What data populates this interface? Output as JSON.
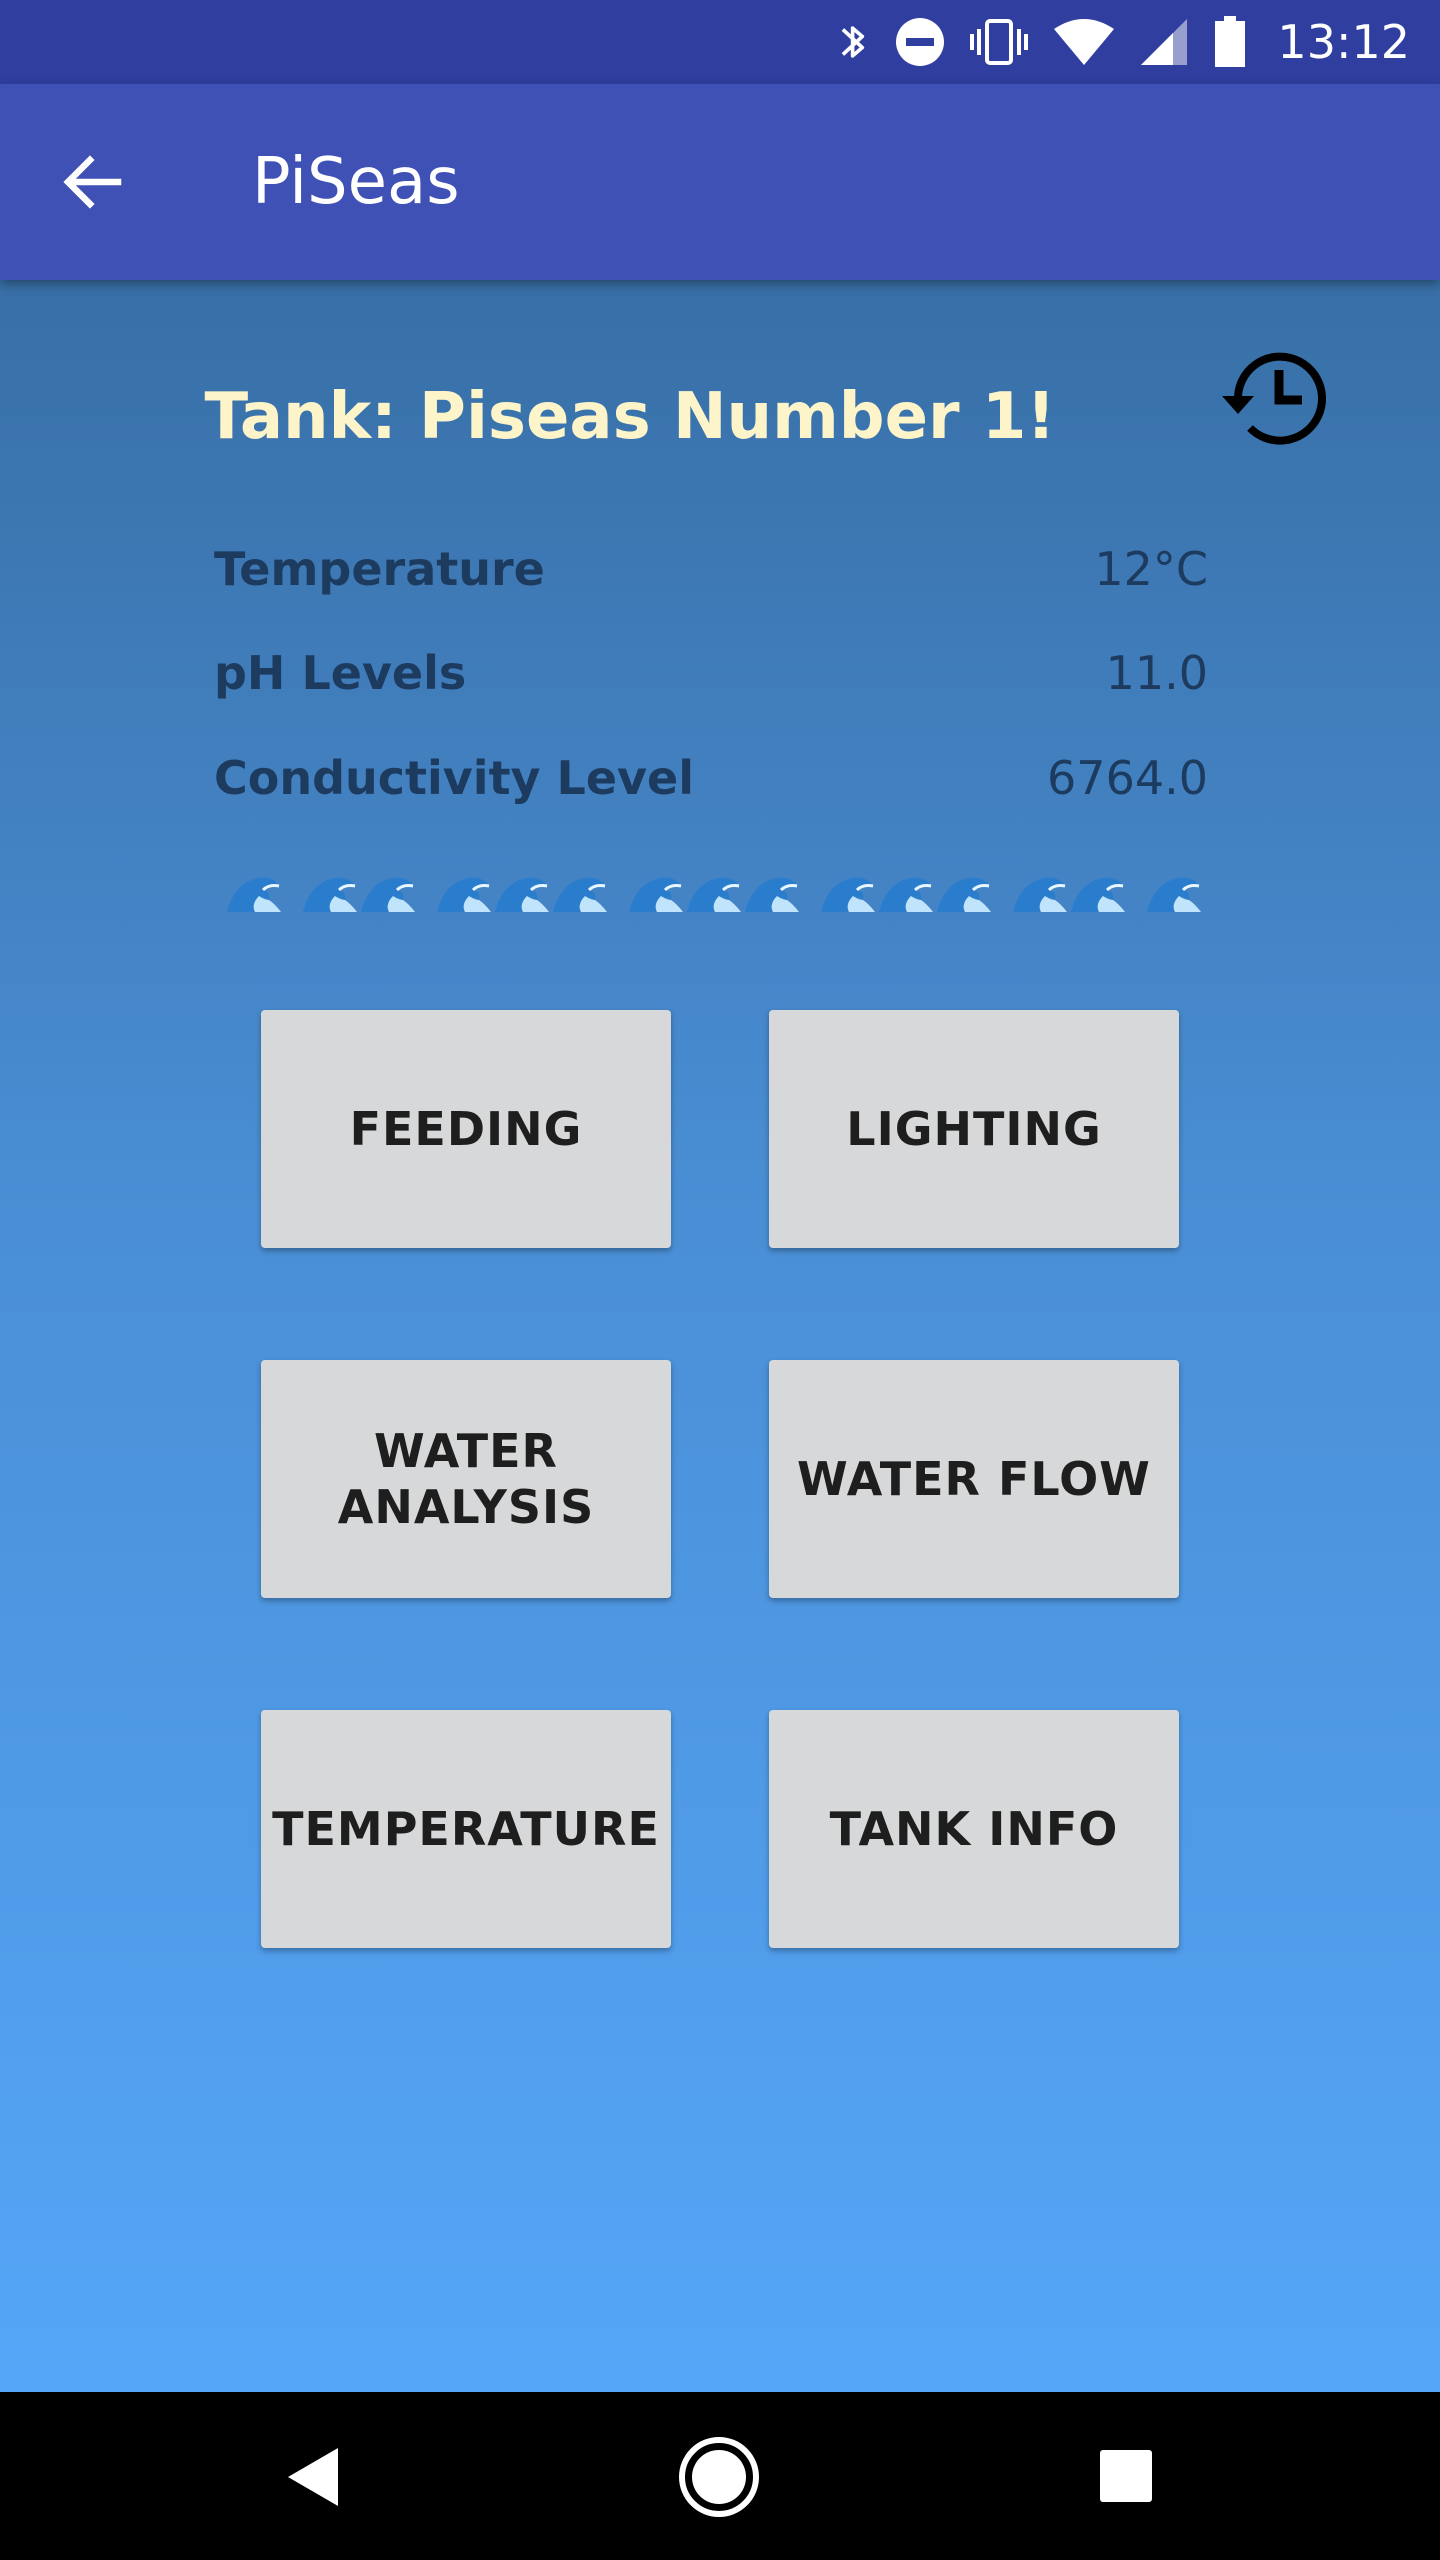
{
  "status_bar": {
    "time": "13:12",
    "icons": [
      "bluetooth-icon",
      "do-not-disturb-icon",
      "vibrate-icon",
      "wifi-icon",
      "signal-icon",
      "battery-icon"
    ]
  },
  "app_bar": {
    "title": "PiSeas",
    "back_icon": "arrow-back-icon"
  },
  "tank": {
    "title": "Tank: Piseas Number 1!",
    "history_icon": "history-icon",
    "readings": [
      {
        "label": "Temperature",
        "value": "12°C"
      },
      {
        "label": "pH Levels",
        "value": "11.0"
      },
      {
        "label": "Conductivity Level",
        "value": "6764.0"
      }
    ]
  },
  "buttons": {
    "feeding": "FEEDING",
    "lighting": "LIGHTING",
    "water_analysis_line1": "WATER",
    "water_analysis_line2": "ANALYSIS",
    "water_flow": "WATER FLOW",
    "temperature": "TEMPERATURE",
    "tank_info": "TANK INFO"
  },
  "nav_bar": {
    "icons": [
      "back-triangle-icon",
      "home-circle-icon",
      "recents-square-icon"
    ]
  },
  "colors": {
    "status_bar": "#303f9f",
    "app_bar": "#3f51b5",
    "title_text": "#fdf5c9",
    "button_bg": "#d7d8d9"
  }
}
